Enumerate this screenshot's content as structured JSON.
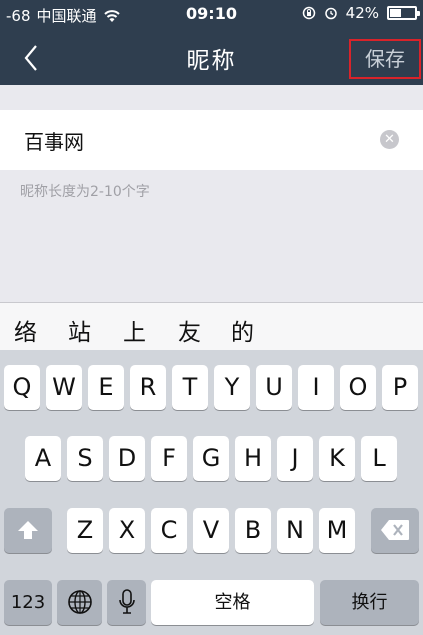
{
  "status_bar": {
    "signal": "-68",
    "carrier": "中国联通",
    "time": "09:10",
    "battery": "42%",
    "battery_level": 0.42
  },
  "nav": {
    "title": "昵称",
    "save_label": "保存",
    "back_icon": "chevron-left-icon"
  },
  "nickname": {
    "value": "百事网",
    "clear_icon": "clear-icon"
  },
  "hint": "昵称长度为2-10个字",
  "candidates": [
    "络",
    "站",
    "上",
    "友",
    "的"
  ],
  "keyboard": {
    "row1": [
      "Q",
      "W",
      "E",
      "R",
      "T",
      "Y",
      "U",
      "I",
      "O",
      "P"
    ],
    "row2": [
      "A",
      "S",
      "D",
      "F",
      "G",
      "H",
      "J",
      "K",
      "L"
    ],
    "row3": [
      "Z",
      "X",
      "C",
      "V",
      "B",
      "N",
      "M"
    ],
    "numbers_label": "123",
    "space_label": "空格",
    "return_label": "换行",
    "shift_icon": "shift-icon",
    "backspace_icon": "backspace-icon",
    "globe_icon": "globe-icon",
    "mic_icon": "microphone-icon"
  }
}
